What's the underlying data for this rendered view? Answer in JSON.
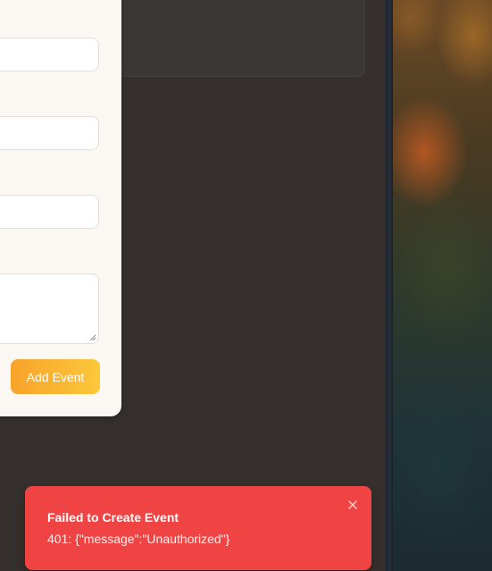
{
  "form": {
    "submit_label": "Add Event"
  },
  "toast": {
    "title": "Failed to Create Event",
    "message": "401: {\"message\":\"Unauthorized\"}",
    "color": "#f04444"
  },
  "icons": {
    "close": "close-icon",
    "resize": "resize-grip-icon"
  },
  "colors": {
    "accent_start": "#f7a32a",
    "accent_end": "#fcc83a",
    "background": "#35302e"
  }
}
